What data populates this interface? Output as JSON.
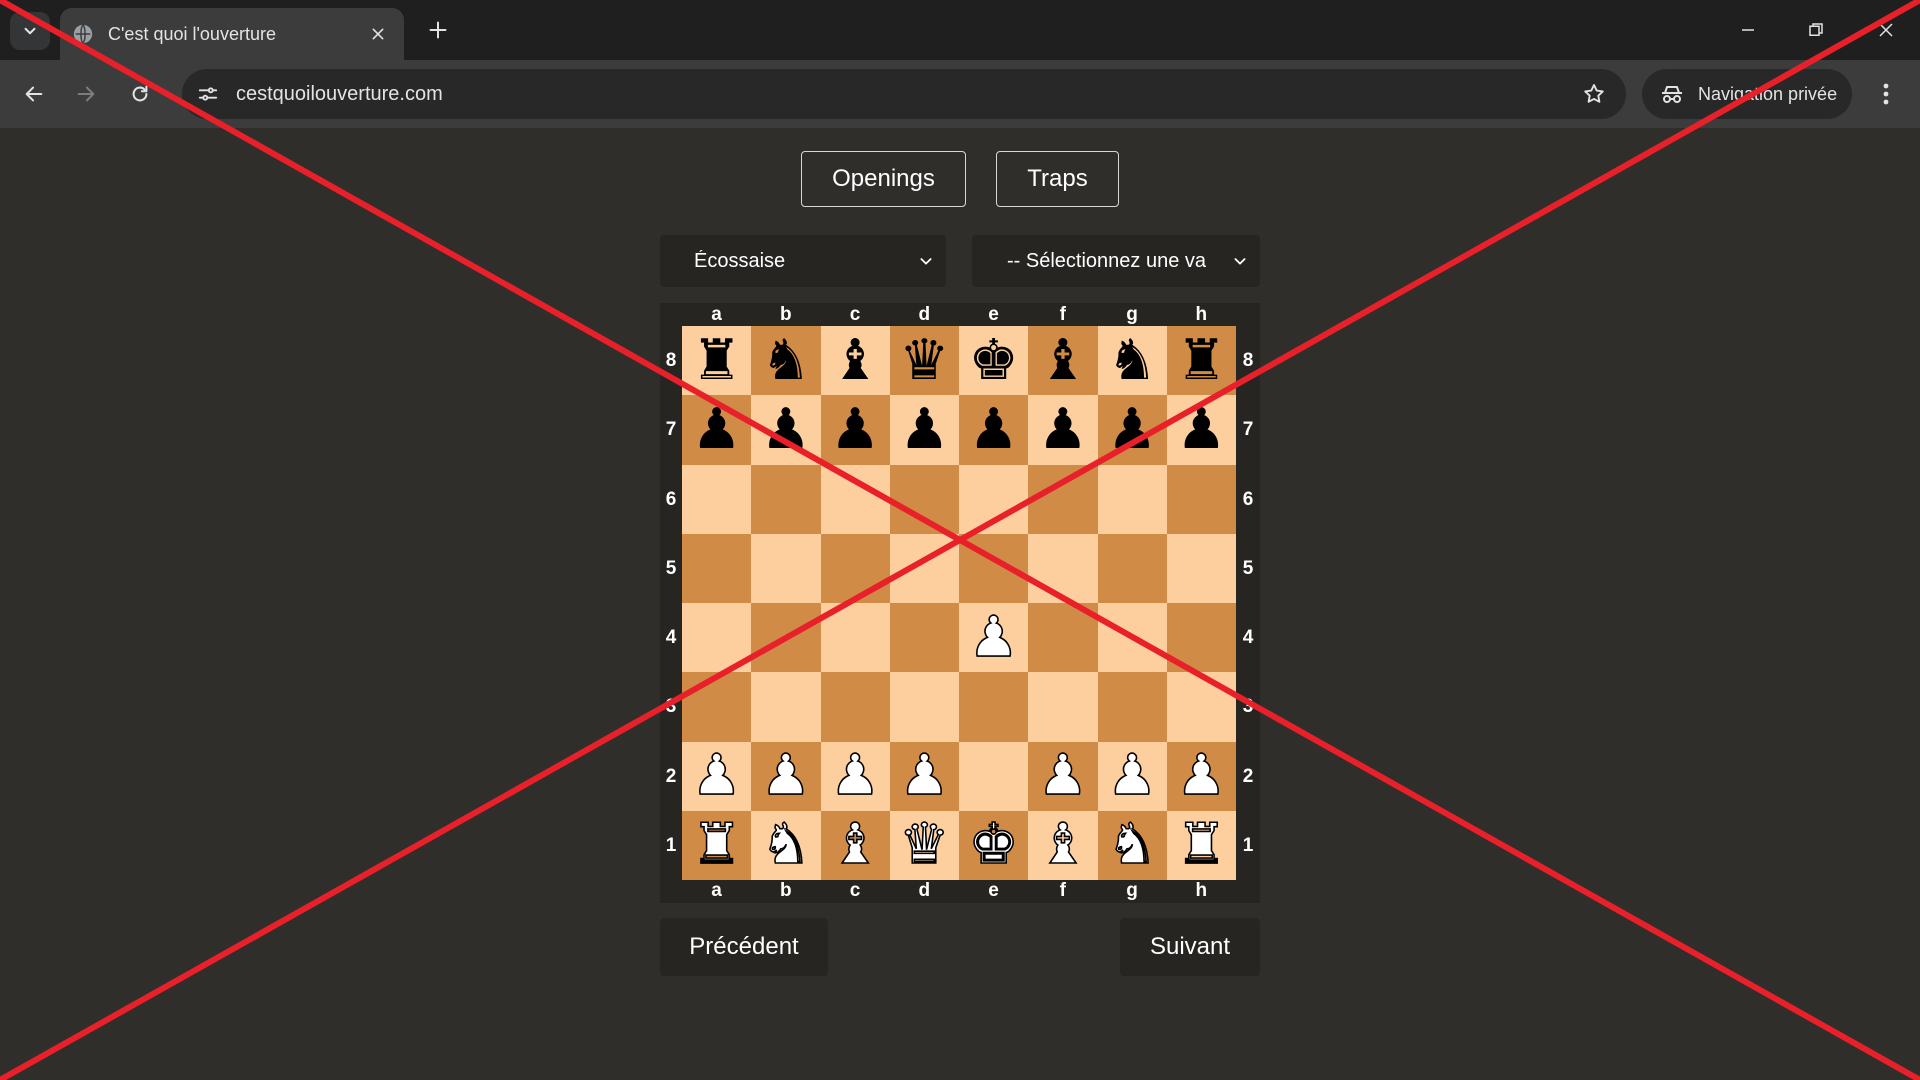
{
  "browser": {
    "tab_title": "C'est quoi l'ouverture",
    "url": "cestquoilouverture.com",
    "incognito_label": "Navigation privée",
    "icons": {
      "tab_search": "chevron-down-icon",
      "favicon": "globe-icon",
      "tab_close": "close-icon",
      "new_tab": "plus-icon",
      "minimize": "minimize-icon",
      "restore": "restore-icon",
      "close_window": "close-icon",
      "back": "arrow-left-icon",
      "forward": "arrow-right-icon",
      "reload": "reload-icon",
      "site_info": "tune-icon",
      "bookmark": "star-icon",
      "incognito": "incognito-icon",
      "menu": "more-vert-icon"
    }
  },
  "nav_buttons": {
    "openings": "Openings",
    "traps": "Traps"
  },
  "selects": {
    "opening": "Écossaise",
    "variation": "-- Sélectionnez une va"
  },
  "board": {
    "files": [
      "a",
      "b",
      "c",
      "d",
      "e",
      "f",
      "g",
      "h"
    ],
    "ranks": [
      "8",
      "7",
      "6",
      "5",
      "4",
      "3",
      "2",
      "1"
    ],
    "rows": [
      [
        "♜",
        "♞",
        "♝",
        "♛",
        "♚",
        "♝",
        "♞",
        "♜"
      ],
      [
        "♟",
        "♟",
        "♟",
        "♟",
        "♟",
        "♟",
        "♟",
        "♟"
      ],
      [
        "",
        "",
        "",
        "",
        "",
        "",
        "",
        ""
      ],
      [
        "",
        "",
        "",
        "",
        "",
        "",
        "",
        ""
      ],
      [
        "",
        "",
        "",
        "",
        "♟",
        "",
        "",
        ""
      ],
      [
        "",
        "",
        "",
        "",
        "",
        "",
        "",
        ""
      ],
      [
        "♟",
        "♟",
        "♟",
        "♟",
        "",
        "♟",
        "♟",
        "♟"
      ],
      [
        "♜",
        "♞",
        "♝",
        "♛",
        "♚",
        "♝",
        "♞",
        "♜"
      ]
    ],
    "colors": [
      [
        "b",
        "b",
        "b",
        "b",
        "b",
        "b",
        "b",
        "b"
      ],
      [
        "b",
        "b",
        "b",
        "b",
        "b",
        "b",
        "b",
        "b"
      ],
      [
        "",
        "",
        "",
        "",
        "",
        "",
        "",
        ""
      ],
      [
        "",
        "",
        "",
        "",
        "",
        "",
        "",
        ""
      ],
      [
        "",
        "",
        "",
        "",
        "w",
        "",
        "",
        ""
      ],
      [
        "",
        "",
        "",
        "",
        "",
        "",
        "",
        ""
      ],
      [
        "w",
        "w",
        "w",
        "w",
        "",
        "w",
        "w",
        "w"
      ],
      [
        "w",
        "w",
        "w",
        "w",
        "w",
        "w",
        "w",
        "w"
      ]
    ],
    "light_color": "#fdcf9e",
    "dark_color": "#d08b47"
  },
  "controls": {
    "previous": "Précédent",
    "next": "Suivant"
  },
  "overlay_color": "#e8202a"
}
